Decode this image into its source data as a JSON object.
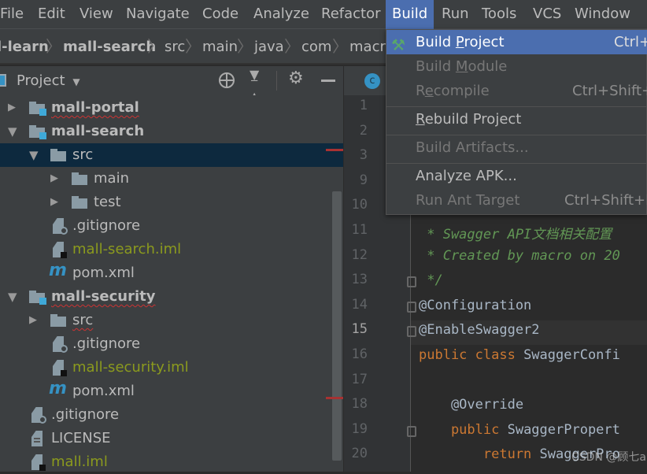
{
  "menubar": {
    "items": [
      {
        "label": "File"
      },
      {
        "label": "Edit"
      },
      {
        "label": "View"
      },
      {
        "label": "Navigate"
      },
      {
        "label": "Code"
      },
      {
        "label": "Analyze"
      },
      {
        "label": "Refactor"
      },
      {
        "label": "Build",
        "active": true
      },
      {
        "label": "Run"
      },
      {
        "label": "Tools"
      },
      {
        "label": "VCS"
      },
      {
        "label": "Window"
      }
    ]
  },
  "breadcrumb": [
    {
      "label": "l-learn",
      "bold": true
    },
    {
      "label": "mall-search",
      "bold": true
    },
    {
      "label": "src"
    },
    {
      "label": "main"
    },
    {
      "label": "java"
    },
    {
      "label": "com"
    },
    {
      "label": "macro"
    }
  ],
  "project_panel": {
    "title": "Project",
    "icons": [
      "locate-icon",
      "collapse-all-icon",
      "gear-icon",
      "minimize-icon"
    ]
  },
  "tree": [
    {
      "label": "mall-portal",
      "type": "module",
      "depth": 0,
      "expanded": false,
      "bold": true,
      "error": true
    },
    {
      "label": "mall-search",
      "type": "module",
      "depth": 0,
      "expanded": true,
      "bold": true
    },
    {
      "label": "src",
      "type": "folder",
      "depth": 1,
      "expanded": true,
      "selected": true
    },
    {
      "label": "main",
      "type": "folder",
      "depth": 2,
      "expanded": false
    },
    {
      "label": "test",
      "type": "folder",
      "depth": 2,
      "expanded": false
    },
    {
      "label": ".gitignore",
      "type": "ignore",
      "depth": 1
    },
    {
      "label": "mall-search.iml",
      "type": "iml",
      "depth": 1,
      "olive": true
    },
    {
      "label": "pom.xml",
      "type": "maven",
      "depth": 1
    },
    {
      "label": "mall-security",
      "type": "module",
      "depth": 0,
      "expanded": true,
      "bold": true,
      "error": true
    },
    {
      "label": "src",
      "type": "folder",
      "depth": 1,
      "expanded": false,
      "error": true
    },
    {
      "label": ".gitignore",
      "type": "ignore",
      "depth": 1
    },
    {
      "label": "mall-security.iml",
      "type": "iml",
      "depth": 1,
      "olive": true
    },
    {
      "label": "pom.xml",
      "type": "maven",
      "depth": 1
    },
    {
      "label": ".gitignore",
      "type": "ignore",
      "depth": 0,
      "root": true
    },
    {
      "label": "LICENSE",
      "type": "text",
      "depth": 0,
      "root": true
    },
    {
      "label": "mall.iml",
      "type": "iml",
      "depth": 0,
      "root": true,
      "olive": true
    }
  ],
  "editor": {
    "tab_icon": "class-icon",
    "tab_icon_letter": "c",
    "line_numbers": [
      "1",
      "2",
      "3",
      "9",
      "10",
      "11",
      "12",
      "13",
      "14",
      "15",
      "16",
      "17",
      "18",
      "19",
      "20"
    ],
    "current_line": "15",
    "code": [
      {
        "line": "11",
        "parts": [
          {
            "t": " * Swagger API文档相关配置",
            "c": "cm"
          }
        ]
      },
      {
        "line": "12",
        "parts": [
          {
            "t": " * Created by macro on 20",
            "c": "cm"
          }
        ]
      },
      {
        "line": "13",
        "parts": [
          {
            "t": " */",
            "c": "cm"
          }
        ]
      },
      {
        "line": "14",
        "parts": [
          {
            "t": "@Configuration",
            "c": ""
          }
        ]
      },
      {
        "line": "15",
        "parts": [
          {
            "t": "@EnableSwagger2",
            "c": ""
          }
        ]
      },
      {
        "line": "16",
        "parts": [
          {
            "t": "public class ",
            "c": "kw"
          },
          {
            "t": "SwaggerConfi",
            "c": ""
          }
        ]
      },
      {
        "line": "17",
        "parts": []
      },
      {
        "line": "18",
        "parts": [
          {
            "t": "    @Override",
            "c": ""
          }
        ]
      },
      {
        "line": "19",
        "parts": [
          {
            "t": "    public ",
            "c": "kw"
          },
          {
            "t": "SwaggerPropert",
            "c": ""
          }
        ]
      },
      {
        "line": "20",
        "parts": [
          {
            "t": "        return ",
            "c": "kw"
          },
          {
            "t": "SwaggerPro",
            "c": ""
          }
        ]
      }
    ]
  },
  "build_menu": {
    "items": [
      {
        "label": "Build Project",
        "mn": "P",
        "shortcut": "Ctrl+",
        "highlighted": true,
        "icon": "hammer-icon"
      },
      {
        "label": "Build Module",
        "mn": "M",
        "shortcut": "",
        "disabled": true
      },
      {
        "label": "Recompile",
        "mn": "e",
        "shortcut": "Ctrl+Shift+",
        "disabled": true,
        "sep_after": true
      },
      {
        "label": "Rebuild Project",
        "mn": "R",
        "shortcut": "",
        "sep_after": true
      },
      {
        "label": "Build Artifacts...",
        "mn": "",
        "shortcut": "",
        "disabled": true,
        "sep_after": true
      },
      {
        "label": "Analyze APK...",
        "mn": "",
        "shortcut": ""
      },
      {
        "label": "Run Ant Target",
        "mn": "",
        "shortcut": "Ctrl+Shift+F",
        "disabled": true
      }
    ]
  },
  "watermark": "CSDN @顾七a",
  "colors": {
    "accent": "#4b6eaf",
    "selection": "#0d293e",
    "module_icon": "#3fa9d8",
    "comment": "#629755",
    "keyword": "#cc7832"
  }
}
